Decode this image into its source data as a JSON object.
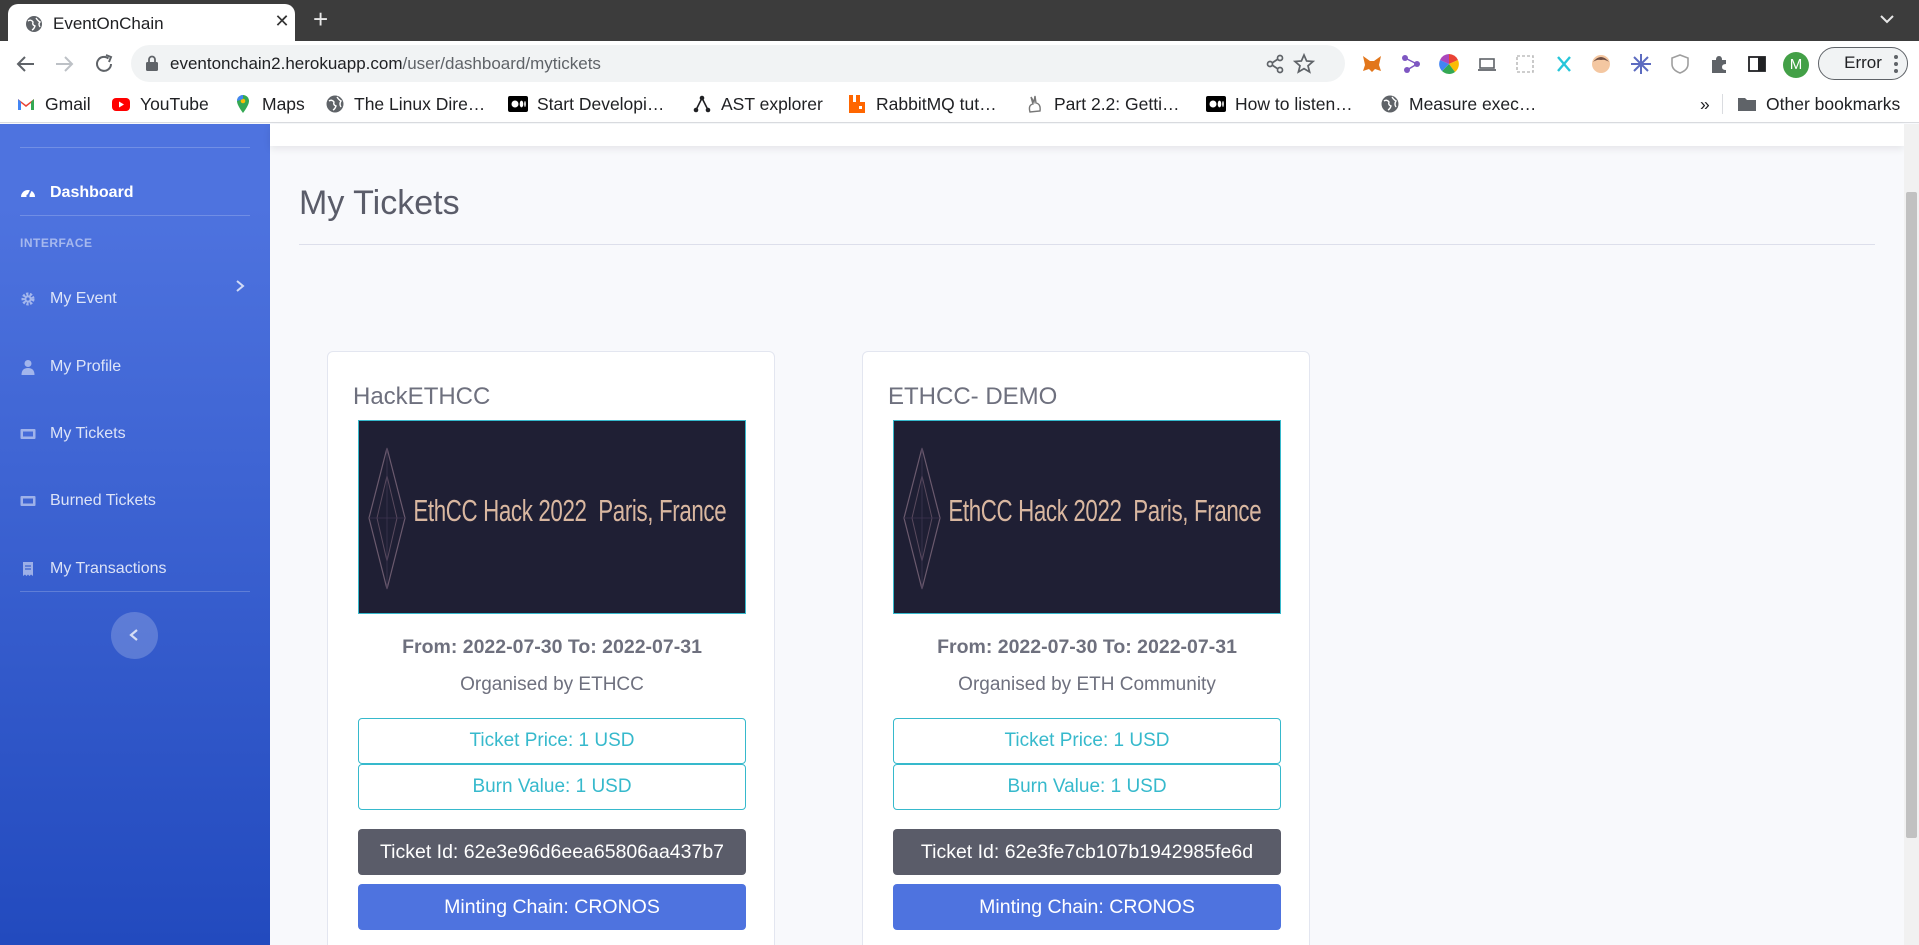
{
  "browser": {
    "tab_title": "EventOnChain",
    "url_host": "eventonchain2.herokuapp.com",
    "url_path": "/user/dashboard/mytickets",
    "profile_initial": "M",
    "error_label": "Error",
    "bookmarks": [
      {
        "label": "Gmail",
        "icon": "gmail-icon",
        "color": "#ea4335"
      },
      {
        "label": "YouTube",
        "icon": "youtube-icon",
        "color": "#ff0000"
      },
      {
        "label": "Maps",
        "icon": "maps-icon",
        "color": "#34a853"
      },
      {
        "label": "The Linux Dire…",
        "icon": "globe-icon",
        "color": "#5f6368"
      },
      {
        "label": "Start Developi…",
        "icon": "medium-icon",
        "color": "#000000"
      },
      {
        "label": "AST explorer",
        "icon": "ast-icon",
        "color": "#202124"
      },
      {
        "label": "RabbitMQ tut…",
        "icon": "rabbitmq-icon",
        "color": "#ff6600"
      },
      {
        "label": "Part 2.2: Getti…",
        "icon": "rabbit-icon",
        "color": "#777777"
      },
      {
        "label": "How to listen…",
        "icon": "medium-icon",
        "color": "#000000"
      },
      {
        "label": "Measure exec…",
        "icon": "globe-icon",
        "color": "#5f6368"
      }
    ],
    "bookmarks_overflow": "»",
    "other_bookmarks": "Other bookmarks"
  },
  "sidebar": {
    "dashboard": "Dashboard",
    "heading": "INTERFACE",
    "items": [
      {
        "label": "My Event",
        "icon": "cog-icon"
      },
      {
        "label": "My Profile",
        "icon": "user-icon"
      },
      {
        "label": "My Tickets",
        "icon": "ticket-icon"
      },
      {
        "label": "Burned Tickets",
        "icon": "ticket-icon"
      },
      {
        "label": "My Transactions",
        "icon": "receipt-icon"
      }
    ]
  },
  "page": {
    "title": "My Tickets"
  },
  "tickets": [
    {
      "event": "HackETHCC",
      "banner": "EthCC Hack 2022  Paris, France",
      "dates": "From: 2022-07-30 To: 2022-07-31",
      "organiser": "Organised by ETHCC",
      "price": "Ticket Price: 1 USD",
      "burn": "Burn Value: 1 USD",
      "ticket_id": "Ticket Id: 62e3e96d6eea65806aa437b7",
      "chain": "Minting Chain: CRONOS"
    },
    {
      "event": "ETHCC- DEMO",
      "banner": "EthCC Hack 2022  Paris, France",
      "dates": "From: 2022-07-30 To: 2022-07-31",
      "organiser": "Organised by ETH Community",
      "price": "Ticket Price: 1 USD",
      "burn": "Burn Value: 1 USD",
      "ticket_id": "Ticket Id: 62e3fe7cb107b1942985fe6d",
      "chain": "Minting Chain: CRONOS"
    }
  ],
  "colors": {
    "primary": "#4e73df",
    "info": "#36b9cc",
    "secondary": "#5a5c69"
  }
}
